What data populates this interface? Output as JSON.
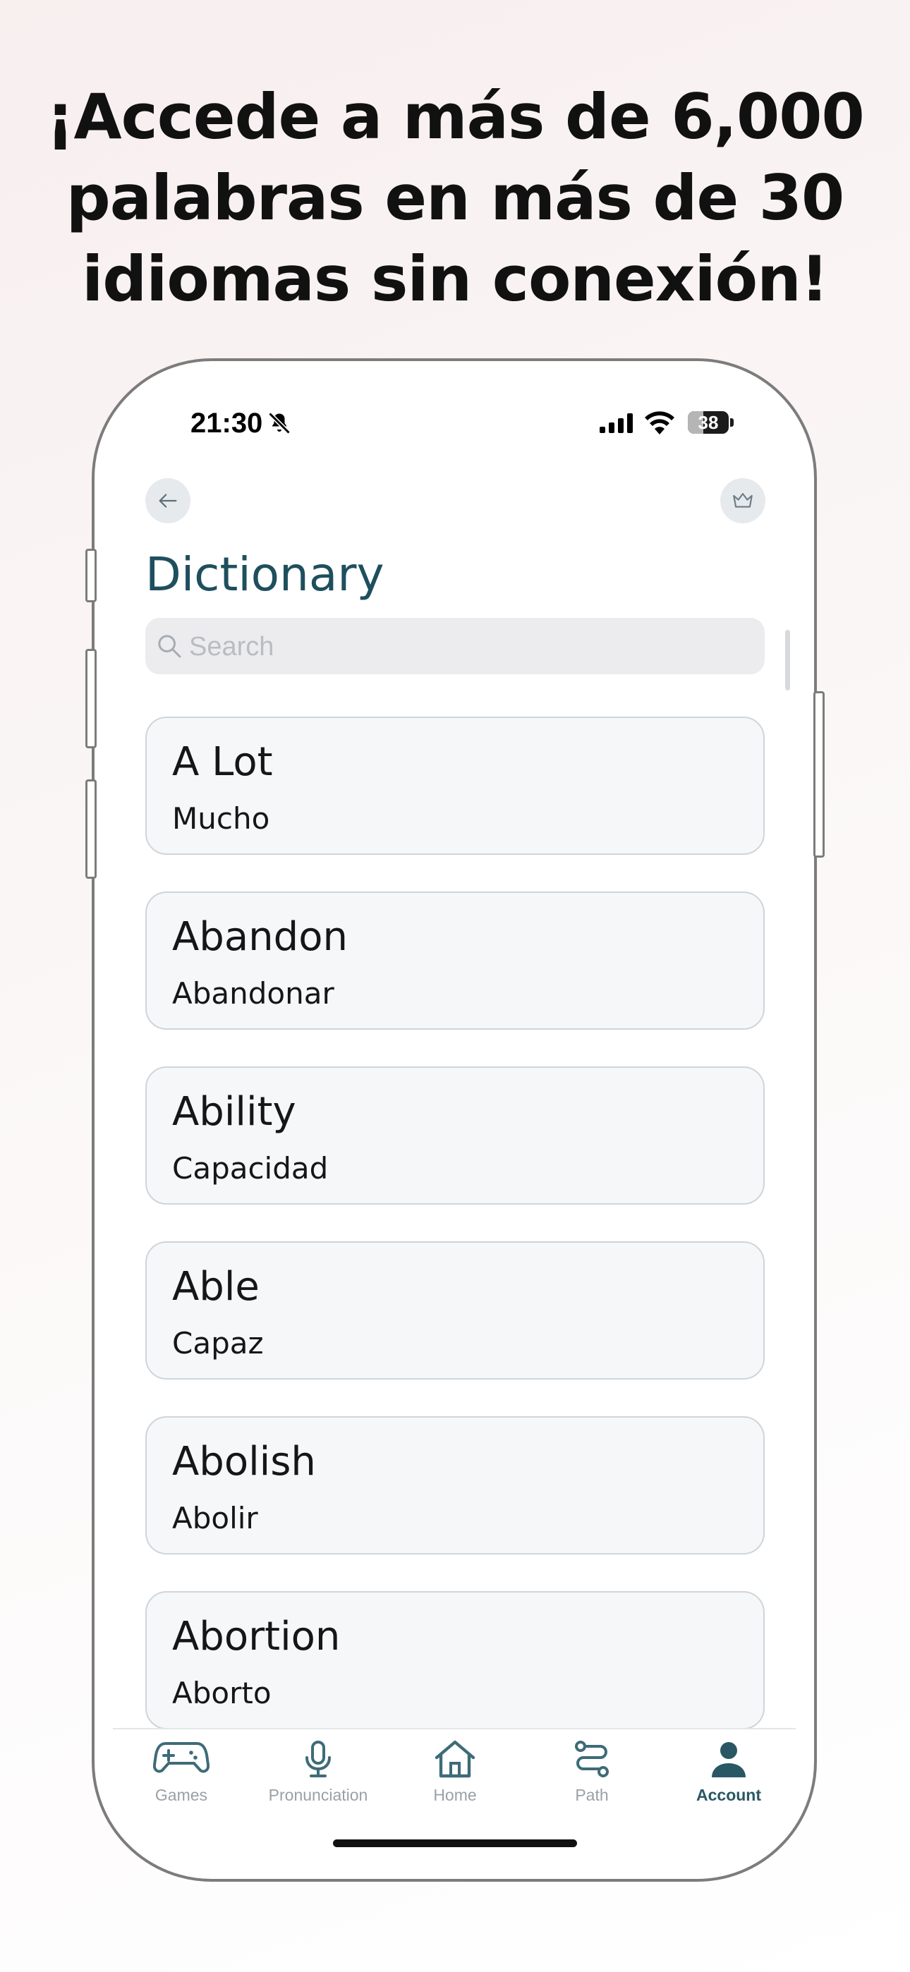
{
  "headline": {
    "line1": "¡Accede a más de 6,000",
    "line2": "palabras en más de 30",
    "line3": "idiomas sin conexión!"
  },
  "status_bar": {
    "time": "21:30",
    "battery": "38",
    "battery_level": 0.38
  },
  "header": {
    "title": "Dictionary",
    "back_icon": "arrow-left-icon",
    "premium_icon": "crown-icon"
  },
  "search": {
    "placeholder": "Search",
    "value": ""
  },
  "entries": [
    {
      "word": "A Lot",
      "translation": "Mucho"
    },
    {
      "word": "Abandon",
      "translation": "Abandonar"
    },
    {
      "word": "Ability",
      "translation": "Capacidad"
    },
    {
      "word": "Able",
      "translation": "Capaz"
    },
    {
      "word": "Abolish",
      "translation": "Abolir"
    },
    {
      "word": "Abortion",
      "translation": "Aborto"
    }
  ],
  "tabbar": {
    "tabs": [
      {
        "label": "Games",
        "icon": "gamepad-icon"
      },
      {
        "label": "Pronunciation",
        "icon": "microphone-icon"
      },
      {
        "label": "Home",
        "icon": "house-icon"
      },
      {
        "label": "Path",
        "icon": "path-icon"
      },
      {
        "label": "Account",
        "icon": "person-icon"
      }
    ],
    "active": "Account"
  },
  "colors": {
    "accent": "#1f4f5d",
    "card_background": "#f6f7f9",
    "card_border": "#cdd6dc",
    "inactive_tab": "#9aa0a6"
  }
}
